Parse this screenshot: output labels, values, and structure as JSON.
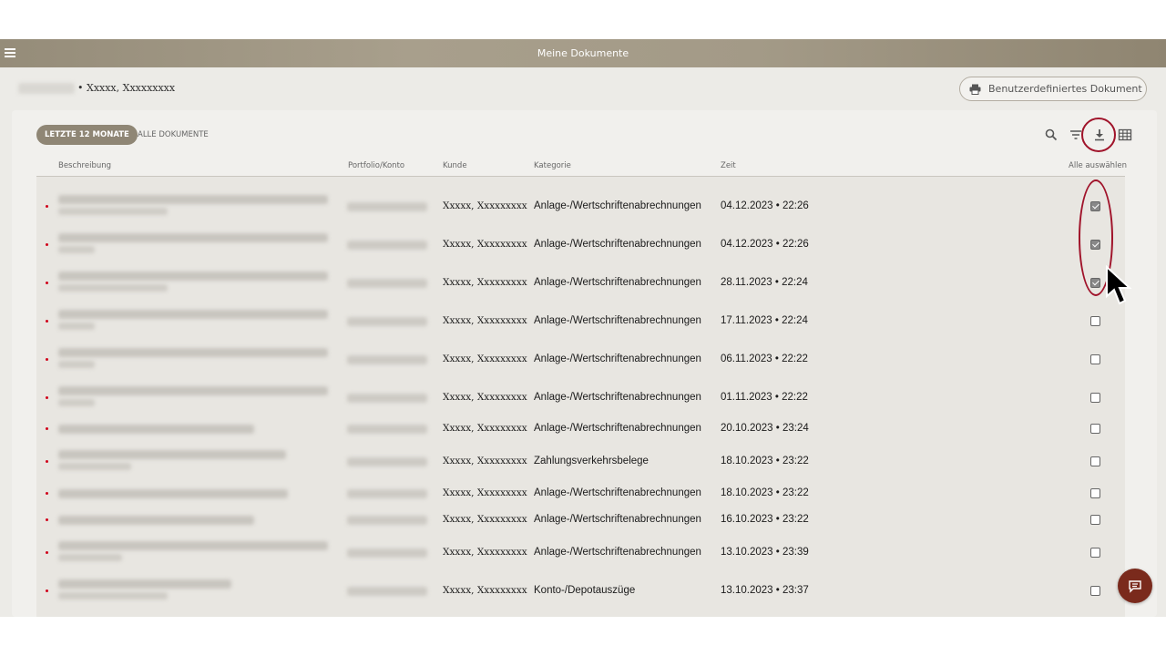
{
  "titlebar": {
    "title": "Meine Dokumente"
  },
  "subheader": {
    "customer": "• Xxxxx, Xxxxxxxxx",
    "custom_document_button": "Benutzerdefiniertes Dokument"
  },
  "tabs": {
    "active": "LETZTE 12 MONATE",
    "inactive": "ALLE DOKUMENTE"
  },
  "toolbar": {
    "icons": [
      "search-icon",
      "filter-icon",
      "download-icon",
      "grid-icon"
    ]
  },
  "table": {
    "headers": {
      "description": "Beschreibung",
      "portfolio": "Portfolio/Konto",
      "customer": "Kunde",
      "category": "Kategorie",
      "time": "Zeit",
      "select_all": "Alle auswählen"
    },
    "rows": [
      {
        "customer": "Xxxxx, Xxxxxxxxx",
        "category": "Anlage-/Wertschriftenabrechnungen",
        "time": "04.12.2023 • 22:26",
        "checked": true
      },
      {
        "customer": "Xxxxx, Xxxxxxxxx",
        "category": "Anlage-/Wertschriftenabrechnungen",
        "time": "04.12.2023 • 22:26",
        "checked": true
      },
      {
        "customer": "Xxxxx, Xxxxxxxxx",
        "category": "Anlage-/Wertschriftenabrechnungen",
        "time": "28.11.2023 • 22:24",
        "checked": true
      },
      {
        "customer": "Xxxxx, Xxxxxxxxx",
        "category": "Anlage-/Wertschriftenabrechnungen",
        "time": "17.11.2023 • 22:24",
        "checked": false
      },
      {
        "customer": "Xxxxx, Xxxxxxxxx",
        "category": "Anlage-/Wertschriftenabrechnungen",
        "time": "06.11.2023 • 22:22",
        "checked": false
      },
      {
        "customer": "Xxxxx, Xxxxxxxxx",
        "category": "Anlage-/Wertschriftenabrechnungen",
        "time": "01.11.2023 • 22:22",
        "checked": false
      },
      {
        "customer": "Xxxxx, Xxxxxxxxx",
        "category": "Anlage-/Wertschriftenabrechnungen",
        "time": "20.10.2023 • 23:24",
        "checked": false
      },
      {
        "customer": "Xxxxx, Xxxxxxxxx",
        "category": "Zahlungsverkehrsbelege",
        "time": "18.10.2023 • 23:22",
        "checked": false
      },
      {
        "customer": "Xxxxx, Xxxxxxxxx",
        "category": "Anlage-/Wertschriftenabrechnungen",
        "time": "18.10.2023 • 23:22",
        "checked": false
      },
      {
        "customer": "Xxxxx, Xxxxxxxxx",
        "category": "Anlage-/Wertschriftenabrechnungen",
        "time": "16.10.2023 • 23:22",
        "checked": false
      },
      {
        "customer": "Xxxxx, Xxxxxxxxx",
        "category": "Anlage-/Wertschriftenabrechnungen",
        "time": "13.10.2023 • 23:39",
        "checked": false
      },
      {
        "customer": "Xxxxx, Xxxxxxxxx",
        "category": "Konto-/Depotauszüge",
        "time": "13.10.2023 • 23:37",
        "checked": false
      }
    ]
  },
  "colors": {
    "header": "#a39a87",
    "accent_tab": "#8f8675",
    "highlight": "#a0132a",
    "chat_button": "#7a2a1c",
    "row_dot": "#d0021b"
  }
}
